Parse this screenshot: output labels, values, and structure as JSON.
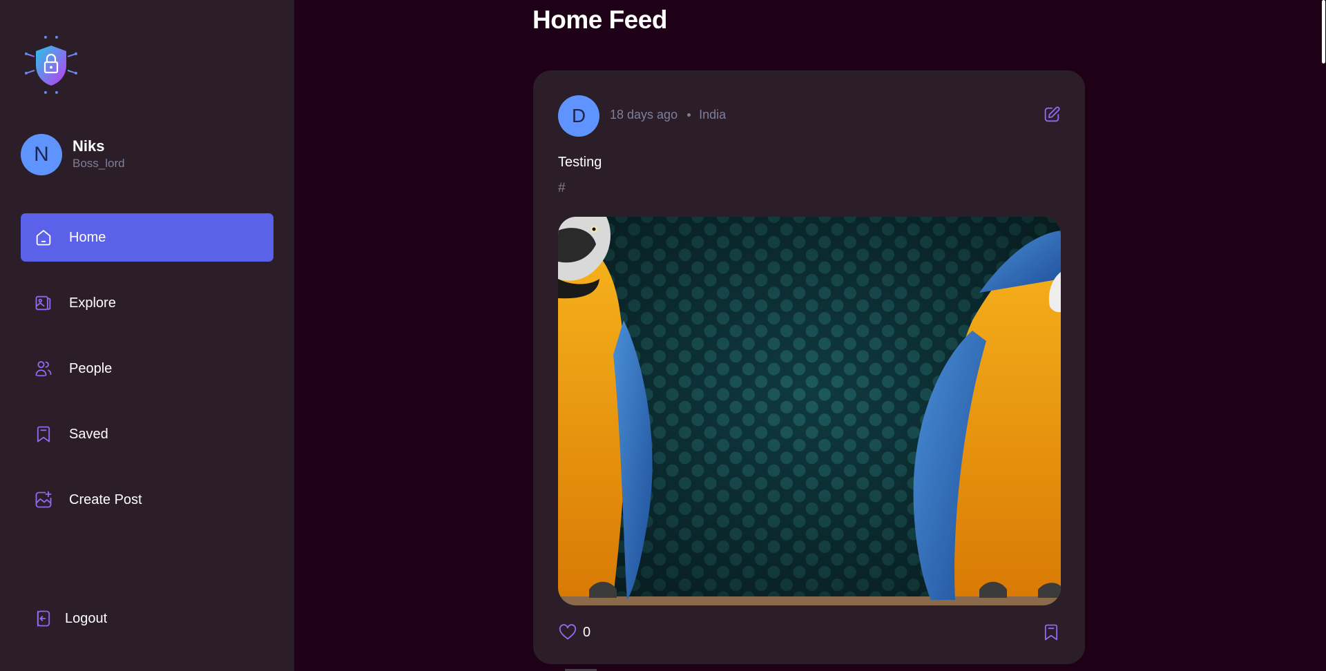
{
  "page": {
    "title": "Home Feed"
  },
  "user": {
    "initial": "N",
    "name": "Niks",
    "handle": "Boss_lord"
  },
  "sidebar": {
    "items": [
      {
        "label": "Home",
        "icon": "home-icon",
        "active": true
      },
      {
        "label": "Explore",
        "icon": "gallery-icon",
        "active": false
      },
      {
        "label": "People",
        "icon": "people-icon",
        "active": false
      },
      {
        "label": "Saved",
        "icon": "bookmark-icon",
        "active": false
      },
      {
        "label": "Create Post",
        "icon": "image-add-icon",
        "active": false
      }
    ],
    "logout_label": "Logout"
  },
  "post": {
    "author_initial": "D",
    "time_ago": "18 days ago",
    "location": "India",
    "caption": "Testing",
    "tags": "#",
    "likes": "0",
    "image": "two blue-and-yellow macaws against a dark teal mesh background"
  },
  "colors": {
    "background": "#1f0117",
    "sidebar": "#2c1e28",
    "accent": "#5c61e9",
    "avatar": "#5f94ff",
    "muted_text": "#7d7f9c",
    "icon_purple": "#8c6bf0"
  }
}
